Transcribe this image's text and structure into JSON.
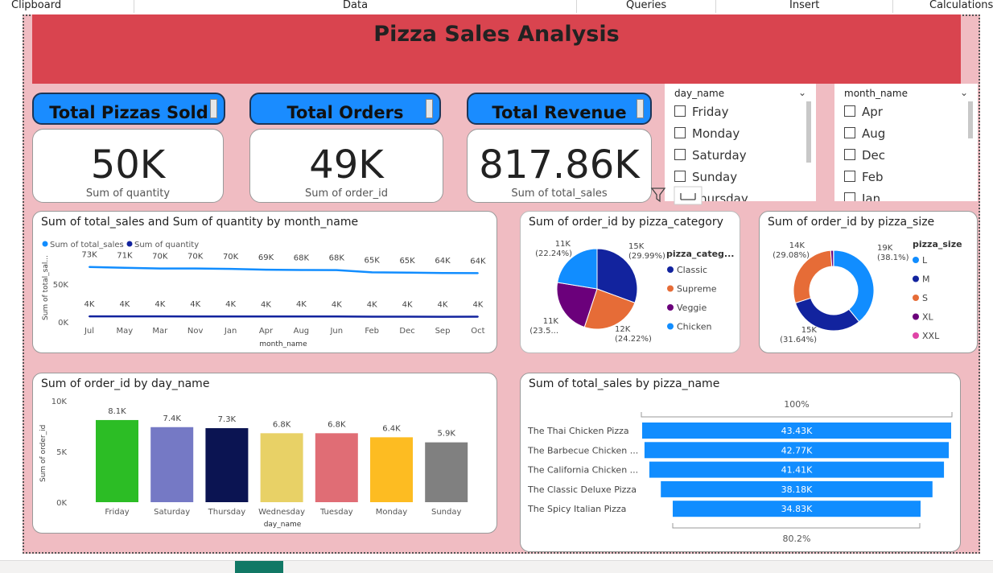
{
  "ribbon": {
    "items": [
      "Clipboard",
      "Data",
      "Queries",
      "Insert",
      "Calculations"
    ]
  },
  "dashboard": {
    "title": "Pizza Sales Analysis"
  },
  "kpis": [
    {
      "title": "Total Pizzas Sold",
      "value": "50K",
      "subtitle": "Sum of quantity"
    },
    {
      "title": "Total Orders",
      "value": "49K",
      "subtitle": "Sum of order_id"
    },
    {
      "title": "Total Revenue",
      "value": "817.86K",
      "subtitle": "Sum of total_sales"
    }
  ],
  "slicers": {
    "day": {
      "header": "day_name",
      "items": [
        "Friday",
        "Monday",
        "Saturday",
        "Sunday",
        "Thursday"
      ]
    },
    "month": {
      "header": "month_name",
      "items": [
        "Apr",
        "Aug",
        "Dec",
        "Feb",
        "Jan"
      ]
    }
  },
  "icons": {
    "dropdown": "chevron-down-icon",
    "filter": "filter-icon",
    "focus": "focus-mode-icon"
  },
  "chart_data": [
    {
      "type": "line",
      "title": "Sum of total_sales and Sum of quantity by month_name",
      "xlabel": "month_name",
      "ylabel": "Sum of total_sal...",
      "legend_position": "top-left",
      "categories": [
        "Jul",
        "May",
        "Mar",
        "Nov",
        "Jan",
        "Apr",
        "Aug",
        "Jun",
        "Feb",
        "Dec",
        "Sep",
        "Oct"
      ],
      "yticks": [
        "0K",
        "50K"
      ],
      "ylim": [
        0,
        90000
      ],
      "series": [
        {
          "name": "Sum of total_sales",
          "color": "#118dff",
          "values": [
            72558,
            71403,
            70397,
            70395,
            69793,
            68737,
            68278,
            68230,
            65160,
            64701,
            64180,
            64028
          ],
          "labels": [
            "73K",
            "71K",
            "70K",
            "70K",
            "70K",
            "69K",
            "68K",
            "68K",
            "65K",
            "65K",
            "64K",
            "64K"
          ]
        },
        {
          "name": "Sum of quantity",
          "color": "#12239e",
          "values": [
            4301,
            4328,
            4261,
            4185,
            4232,
            4151,
            4168,
            4107,
            3892,
            3935,
            3819,
            3822
          ],
          "labels": [
            "4K",
            "4K",
            "4K",
            "4K",
            "4K",
            "4K",
            "4K",
            "4K",
            "4K",
            "4K",
            "4K",
            "4K"
          ]
        }
      ]
    },
    {
      "type": "pie",
      "title": "Sum of order_id by pizza_category",
      "legend_title": "pizza_categ...",
      "legend_position": "right",
      "slices": [
        {
          "name": "Classic",
          "value": 15,
          "percent": 29.99,
          "color": "#12239e",
          "label": "15K",
          "pct_label": "(29.99%)"
        },
        {
          "name": "Supreme",
          "value": 12,
          "percent": 24.22,
          "color": "#e66c37",
          "label": "12K",
          "pct_label": "(24.22%)"
        },
        {
          "name": "Veggie",
          "value": 11,
          "percent": 23.55,
          "color": "#6b007b",
          "label": "11K",
          "pct_label": "(23.5..."
        },
        {
          "name": "Chicken",
          "value": 11,
          "percent": 22.24,
          "color": "#118dff",
          "label": "11K",
          "pct_label": "(22.24%)"
        }
      ]
    },
    {
      "type": "pie",
      "donut": true,
      "title": "Sum of order_id by pizza_size",
      "legend_title": "pizza_size",
      "legend_position": "right",
      "slices": [
        {
          "name": "L",
          "value": 19,
          "percent": 38.1,
          "color": "#118dff",
          "label": "19K",
          "pct_label": "(38.1%)"
        },
        {
          "name": "M",
          "value": 15,
          "percent": 31.64,
          "color": "#12239e",
          "label": "15K",
          "pct_label": "(31.64%)"
        },
        {
          "name": "S",
          "value": 14,
          "percent": 29.08,
          "color": "#e66c37",
          "label": "14K",
          "pct_label": "(29.08%)"
        },
        {
          "name": "XL",
          "value": 0.55,
          "percent": 1.1,
          "color": "#6b007b",
          "label": "",
          "pct_label": ""
        },
        {
          "name": "XXL",
          "value": 0.03,
          "percent": 0.06,
          "color": "#e044a7",
          "label": "",
          "pct_label": ""
        }
      ]
    },
    {
      "type": "bar",
      "title": "Sum of order_id by day_name",
      "xlabel": "day_name",
      "ylabel": "Sum of order_id",
      "ylim": [
        0,
        10000
      ],
      "yticks": [
        "0K",
        "5K",
        "10K"
      ],
      "categories": [
        "Friday",
        "Saturday",
        "Thursday",
        "Wednesday",
        "Tuesday",
        "Monday",
        "Sunday"
      ],
      "values": [
        8100,
        7400,
        7300,
        6800,
        6800,
        6400,
        5900
      ],
      "labels": [
        "8.1K",
        "7.4K",
        "7.3K",
        "6.8K",
        "6.8K",
        "6.4K",
        "5.9K"
      ],
      "colors": [
        "#2cbd25",
        "#7579c5",
        "#0b1452",
        "#e8d166",
        "#e06d75",
        "#fdbc22",
        "#808080"
      ]
    },
    {
      "type": "bar",
      "orientation": "funnel",
      "title": "Sum of total_sales by pizza_name",
      "top_label": "100%",
      "bottom_label": "80.2%",
      "categories": [
        "The Thai Chicken Pizza",
        "The Barbecue Chicken ...",
        "The California Chicken ...",
        "The Classic Deluxe Pizza",
        "The Spicy Italian Pizza"
      ],
      "values": [
        43430,
        42770,
        41410,
        38180,
        34830
      ],
      "labels": [
        "43.43K",
        "42.77K",
        "41.41K",
        "38.18K",
        "34.83K"
      ],
      "color": "#118dff"
    }
  ]
}
